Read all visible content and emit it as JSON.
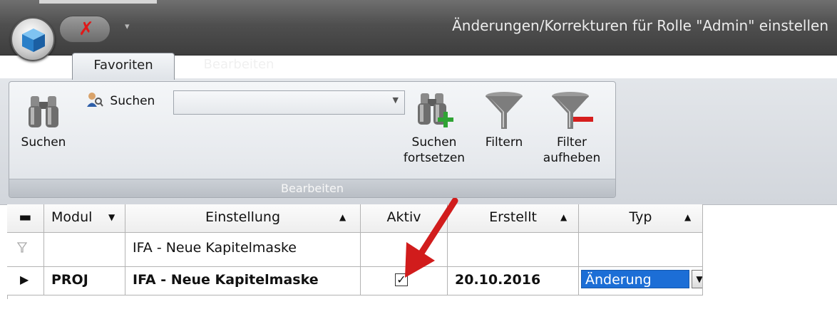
{
  "window": {
    "title": "Änderungen/Korrekturen für Rolle \"Admin\" einstellen",
    "close_glyph": "✗",
    "qat_dropdown_glyph": "▾"
  },
  "tabs": [
    {
      "label": "Favoriten",
      "active": true
    },
    {
      "label": "Bearbeiten",
      "active": false
    }
  ],
  "ribbon": {
    "group_label": "Bearbeiten",
    "search_button": {
      "label": "Suchen",
      "icon": "binoculars-icon"
    },
    "search_small": {
      "label": "Suchen",
      "icon": "user-search-icon"
    },
    "search_combo": {
      "value": "",
      "arrow": "▼"
    },
    "continue_search": {
      "label": "Suchen\nfortsetzen",
      "icon": "binoculars-plus-icon"
    },
    "filter": {
      "label": "Filtern",
      "icon": "funnel-icon"
    },
    "remove_filter": {
      "label": "Filter\naufheben",
      "icon": "funnel-remove-icon"
    }
  },
  "grid": {
    "select_all_glyph": "▬",
    "columns": [
      {
        "label": "Modul",
        "sort": "▼"
      },
      {
        "label": "Einstellung",
        "sort": "▲"
      },
      {
        "label": "Aktiv",
        "sort": ""
      },
      {
        "label": "Erstellt",
        "sort": "▲"
      },
      {
        "label": "Typ",
        "sort": "▲"
      }
    ],
    "filter_row": {
      "icon": "filter-row-icon",
      "modul": "",
      "einstellung": "IFA - Neue Kapitelmaske",
      "aktiv": "",
      "erstellt": "",
      "typ": ""
    },
    "rows": [
      {
        "indicator": "▶",
        "modul": "PROJ",
        "einstellung": "IFA - Neue Kapitelmaske",
        "aktiv": true,
        "aktiv_glyph": "✓",
        "erstellt": "20.10.2016",
        "typ": "Änderung",
        "typ_dropdown": "▼"
      }
    ]
  },
  "colors": {
    "accent_select": "#1c6ed6",
    "annotation_arrow": "#d11c1c",
    "close_x": "#e01818"
  }
}
